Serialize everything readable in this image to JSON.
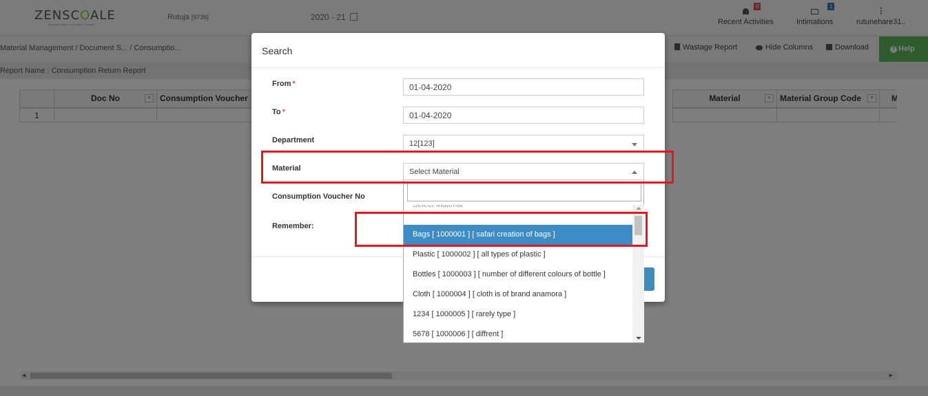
{
  "header": {
    "logo_prefix": "ZENSC",
    "logo_accent": "O",
    "logo_suffix": "ALE",
    "logo_tagline": "Business. Excel. Automation. Process",
    "user_name": "Rutuja",
    "user_code": "[9736]",
    "financial_year": "2020 - 21",
    "recent_activities_label": "Recent Activities",
    "recent_activities_badge": "0",
    "intimations_label": "Intimations",
    "intimations_badge": "1",
    "profile_label": "rutunehare31.."
  },
  "subbar": {
    "breadcrumb": "Material Management  / Document S... / Consumptio...",
    "wastage_report": "Wastage Report",
    "hide_columns": "Hide Columns",
    "download": "Download",
    "help": "Help"
  },
  "report_name": "Report Name : Consumption Return Report",
  "grid": {
    "headers": [
      "Doc No",
      "Consumption Voucher",
      "Material",
      "Material Group Code",
      "M"
    ],
    "row_number": "1"
  },
  "modal": {
    "title": "Search",
    "from_label": "From",
    "from_value": "01-04-2020",
    "to_label": "To",
    "to_value": "01-04-2020",
    "required_mark": "*",
    "department_label": "Department",
    "department_value": "12[123]",
    "material_label": "Material",
    "material_value": "Select Material",
    "consumption_voucher_label": "Consumption Voucher No",
    "remember_label": "Remember:"
  },
  "dropdown": {
    "search_value": "",
    "options": [
      "Select Material",
      "Bags [ 1000001 ] [ safari creation of bags ]",
      "Plastic [ 1000002 ] [ all types of plastic ]",
      "Bottles [ 1000003 ] [ number of different colours of bottle ]",
      "Cloth [ 1000004 ] [ cloth is of brand anamora ]",
      "1234 [ 1000005 ] [ rarely type ]",
      "5678 [ 1000006 ] [ diffrent ]"
    ]
  },
  "colors": {
    "brand_green": "#8cc63f",
    "selected_option": "#3c8dc5",
    "help_button": "#5cb85c",
    "highlight_red": "#e8151b"
  }
}
